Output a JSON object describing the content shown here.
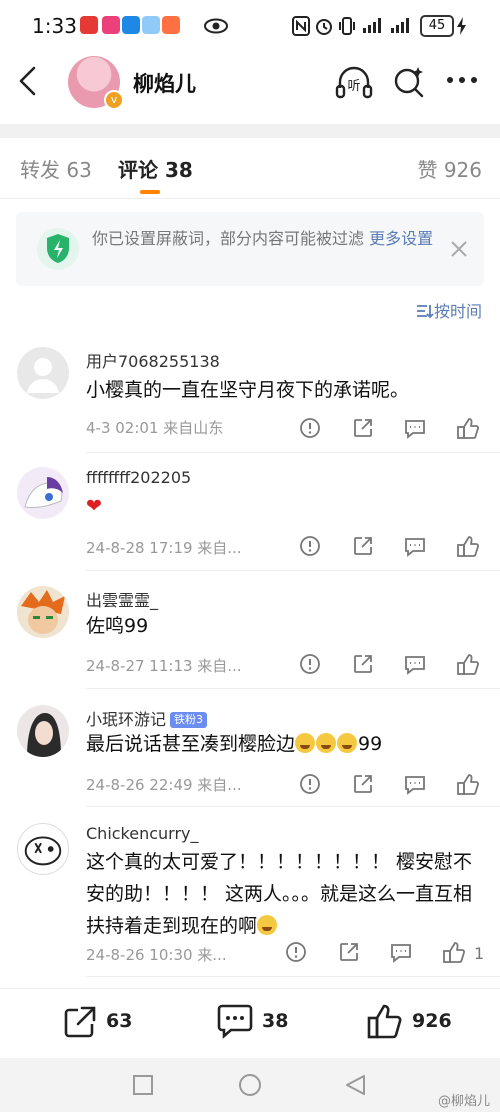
{
  "status_bar": {
    "time": "1:33",
    "battery": "45"
  },
  "header": {
    "title": "柳焰儿",
    "listen_label": "听"
  },
  "tabs": [
    {
      "label": "转发 63"
    },
    {
      "label": "评论 38"
    },
    {
      "label": "赞 926"
    }
  ],
  "banner": {
    "text": "你已设置屏蔽词，部分内容可能被过滤 ",
    "more": "更多设置"
  },
  "sort_label": "按时间",
  "comments": [
    {
      "user": "用户7068255138",
      "text": "小樱真的一直在坚守月夜下的承诺呢。",
      "meta": "4-3 02:01  来自山东"
    },
    {
      "user": "ffffffff202205",
      "text": "❤",
      "meta": "24-8-28 17:19  来自..."
    },
    {
      "user": "出雲霊霊_",
      "text": "佐鸣99",
      "meta": "24-8-27 11:13  来自..."
    },
    {
      "user": "小珉环游记",
      "badge": "铁粉3",
      "text": "最后说话甚至凑到樱脸边",
      "text_suffix": "99",
      "meta": "24-8-26 22:49  来自..."
    },
    {
      "user": "Chickencurry_",
      "text": "这个真的太可爱了！！！！！！！！ 樱安慰不安的助！！！！ 这两人。。。就是这么一直互相扶持着走到现在的啊",
      "meta": "24-8-26 10:30  来...",
      "like_count": "1"
    }
  ],
  "bottom": {
    "repost": "63",
    "comment": "38",
    "like": "926"
  },
  "watermark": "@柳焰儿"
}
